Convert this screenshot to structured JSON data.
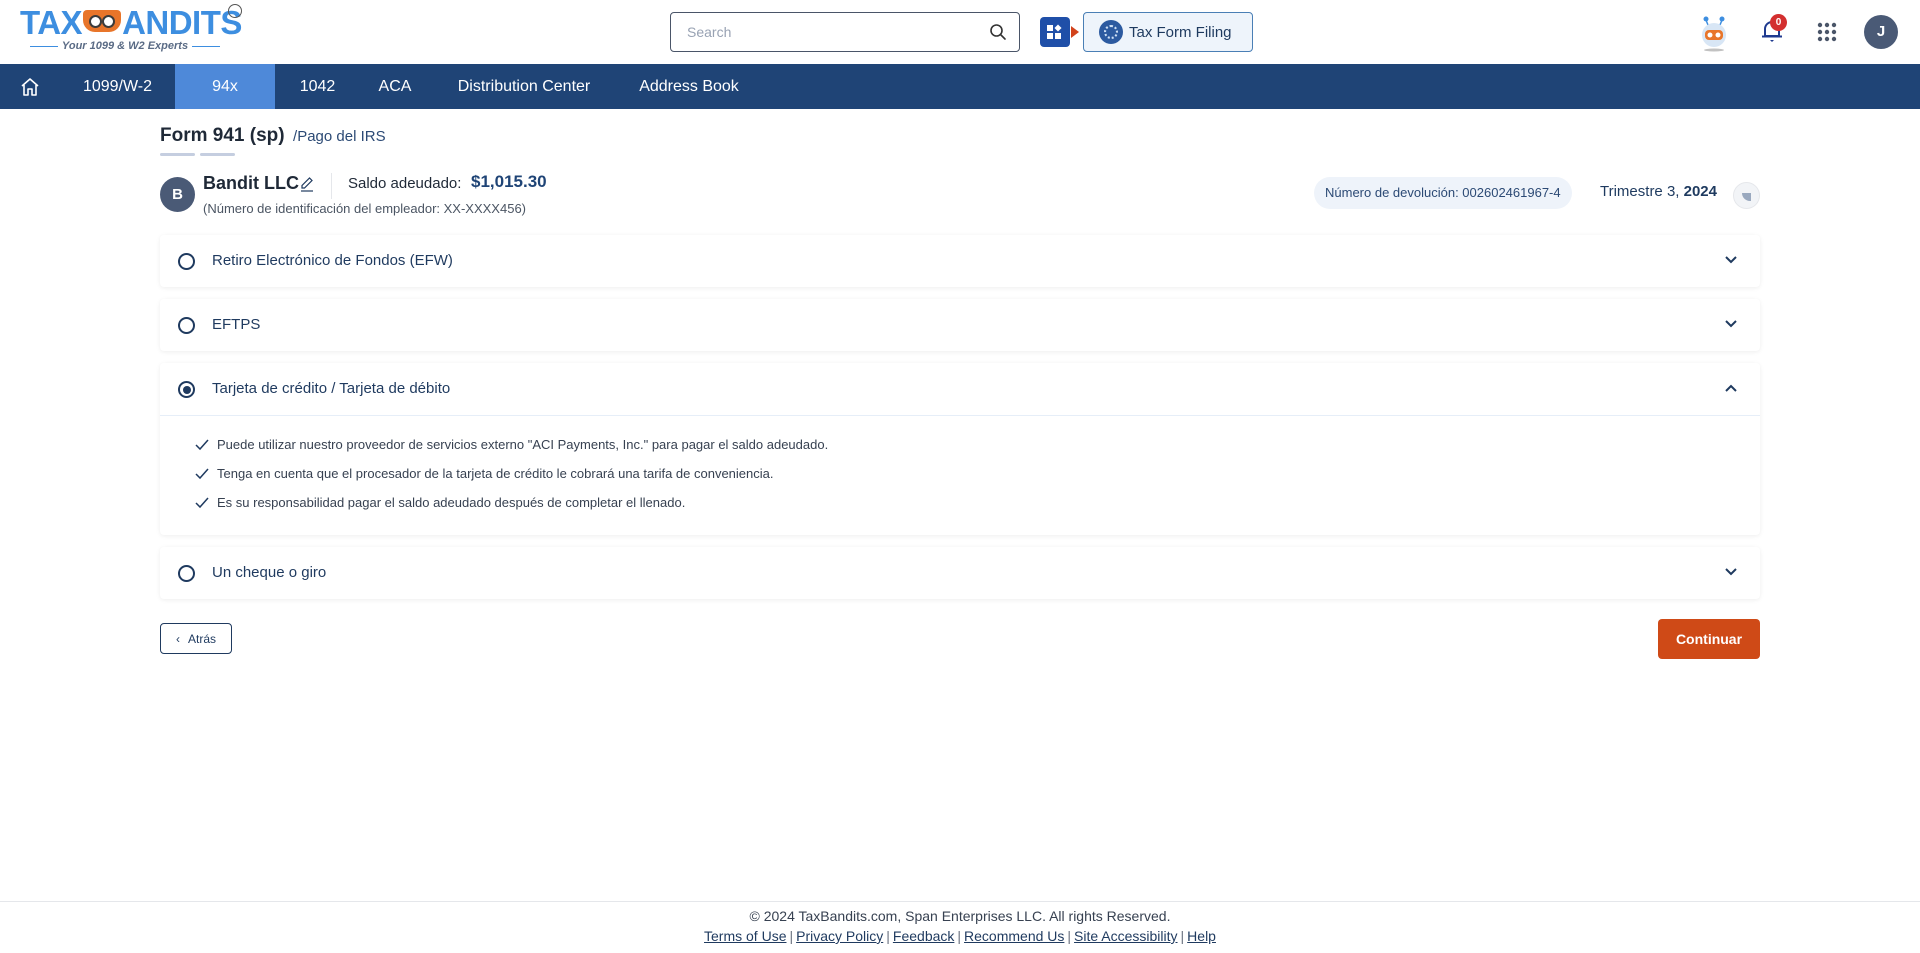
{
  "header": {
    "logo": {
      "brand_left": "TAX",
      "brand_right": "ANDITS",
      "trademark": "TM",
      "tagline": "Your 1099 & W2 Experts"
    },
    "search": {
      "placeholder": "Search",
      "value": ""
    },
    "tax_form_filing_label": "Tax Form Filing",
    "notifications_count": "0",
    "user_initial": "J"
  },
  "nav": {
    "items": [
      {
        "label": "1099/W-2",
        "active": false
      },
      {
        "label": "94x",
        "active": true
      },
      {
        "label": "1042",
        "active": false
      },
      {
        "label": "ACA",
        "active": false
      },
      {
        "label": "Distribution Center",
        "active": false
      },
      {
        "label": "Address Book",
        "active": false
      }
    ]
  },
  "page": {
    "title": "Form 941 (sp)",
    "breadcrumb": "/Pago del IRS",
    "company": {
      "initial": "B",
      "name": "Bandit LLC",
      "balance_label": "Saldo adeudado:",
      "balance_value": "$1,015.30",
      "ein": "(Número de identificación del empleador: XX-XXXX456)"
    },
    "return_number": "Número de devolución: 002602461967-4",
    "quarter_label": "Trimestre 3,",
    "quarter_year": "2024"
  },
  "payment_options": [
    {
      "label": "Retiro Electrónico de Fondos (EFW)",
      "selected": false,
      "expanded": false
    },
    {
      "label": "EFTPS",
      "selected": false,
      "expanded": false
    },
    {
      "label": "Tarjeta de crédito / Tarjeta de débito",
      "selected": true,
      "expanded": true,
      "details": [
        "Puede utilizar nuestro proveedor de servicios externo \"ACI Payments, Inc.\" para pagar el saldo adeudado.",
        "Tenga en cuenta que el procesador de la tarjeta de crédito le cobrará una tarifa de conveniencia.",
        "Es su responsabilidad pagar el saldo adeudado después de completar el llenado."
      ]
    },
    {
      "label": "Un cheque o giro",
      "selected": false,
      "expanded": false
    }
  ],
  "actions": {
    "back_label": "Atrás",
    "continue_label": "Continuar"
  },
  "footer": {
    "copyright": "© 2024 TaxBandits.com, Span Enterprises LLC. All rights Reserved.",
    "links": [
      "Terms of Use",
      "Privacy Policy",
      "Feedback",
      "Recommend Us",
      "Site Accessibility",
      "Help"
    ]
  },
  "colors": {
    "nav_bg": "#1f4476",
    "nav_active": "#4e89d9",
    "primary_text": "#1f3a5f",
    "continue_button": "#cf4a17",
    "brand_blue": "#3d8ee0",
    "badge_red": "#d32f2f"
  }
}
